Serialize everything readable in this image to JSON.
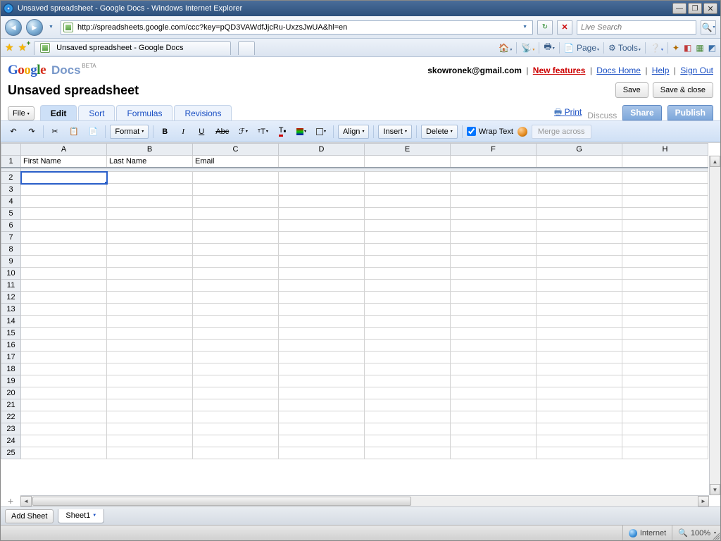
{
  "window": {
    "title": "Unsaved spreadsheet - Google Docs - Windows Internet Explorer"
  },
  "browser": {
    "url": "http://spreadsheets.google.com/ccc?key=pQD3VAWdfJjcRu-UxzsJwUA&hl=en",
    "search_placeholder": "Live Search",
    "tab_title": "Unsaved spreadsheet - Google Docs",
    "cmd": {
      "page": "Page",
      "tools": "Tools"
    }
  },
  "app": {
    "logo_docs": "Docs",
    "account": {
      "email": "skowronek@gmail.com",
      "new_features": "New features",
      "docs_home": "Docs Home",
      "help": "Help",
      "sign_out": "Sign Out"
    },
    "title": "Unsaved spreadsheet",
    "save": "Save",
    "save_close": "Save & close",
    "file_menu": "File",
    "tabs": {
      "edit": "Edit",
      "sort": "Sort",
      "formulas": "Formulas",
      "revisions": "Revisions"
    },
    "rt": {
      "print": "Print",
      "discuss": "Discuss",
      "share": "Share",
      "publish": "Publish"
    },
    "toolbar": {
      "format": "Format",
      "align": "Align",
      "insert": "Insert",
      "delete": "Delete",
      "wrap": "Wrap Text",
      "merge": "Merge across"
    },
    "sheet": {
      "columns": [
        "A",
        "B",
        "C",
        "D",
        "E",
        "F",
        "G",
        "H"
      ],
      "row1": {
        "A": "First Name",
        "B": "Last Name",
        "C": "Email"
      },
      "rows_shown": 25,
      "selected": "A2",
      "add_sheet": "Add Sheet",
      "tab1": "Sheet1"
    }
  },
  "status": {
    "zone": "Internet",
    "zoom": "100%"
  }
}
